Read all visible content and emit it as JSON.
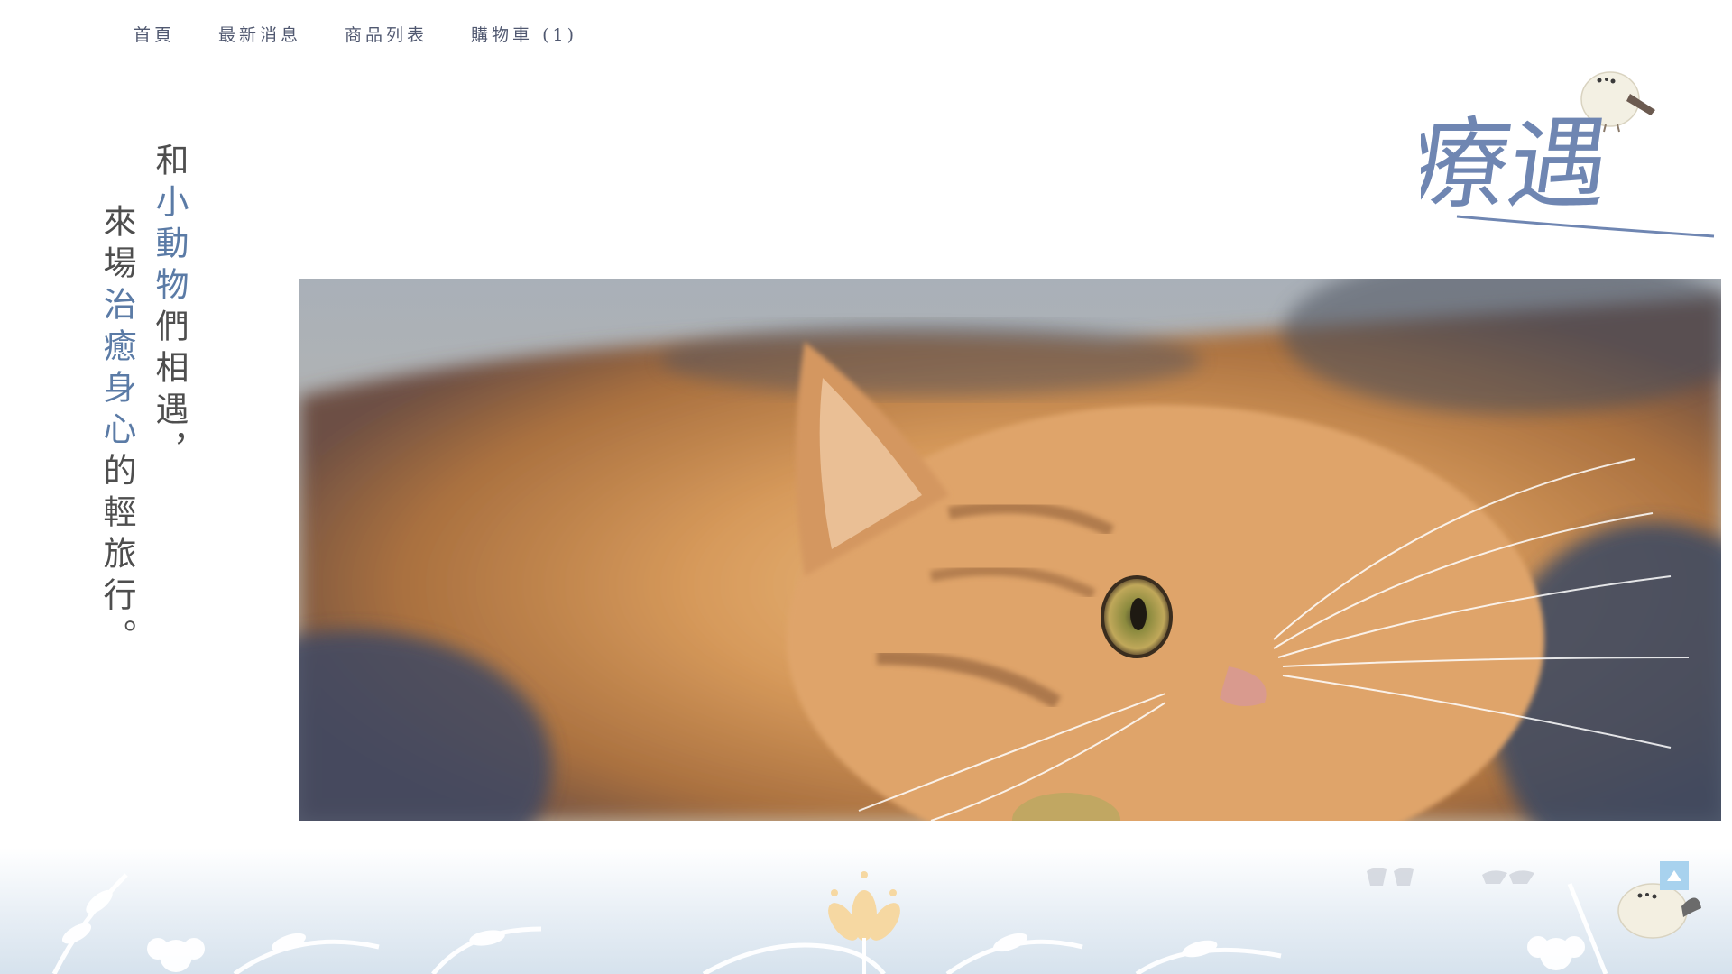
{
  "nav": {
    "items": [
      {
        "label": "首頁"
      },
      {
        "label": "最新消息"
      },
      {
        "label": "商品列表"
      },
      {
        "label": "購物車 (1)"
      }
    ]
  },
  "slogan": {
    "line1": [
      {
        "text": "和",
        "highlight": false
      },
      {
        "text": "小動物",
        "highlight": true
      },
      {
        "text": "們相遇，",
        "highlight": false
      }
    ],
    "line2": [
      {
        "text": "來場",
        "highlight": false
      },
      {
        "text": "治癒身心",
        "highlight": true
      },
      {
        "text": "的輕旅行。",
        "highlight": false
      }
    ]
  },
  "logo": {
    "text": "療遇"
  },
  "colors": {
    "nav_text": "#505870",
    "slogan_text": "#4e4e4e",
    "slogan_highlight": "#5b7ba6",
    "logo_blue": "#6f86b2",
    "to_top_bg": "#a8d2ee",
    "footer_bg": "#dbe6ef"
  },
  "hero": {
    "icon": "hero-cat-photo"
  },
  "back_to_top": {
    "icon": "arrow-up-icon"
  }
}
